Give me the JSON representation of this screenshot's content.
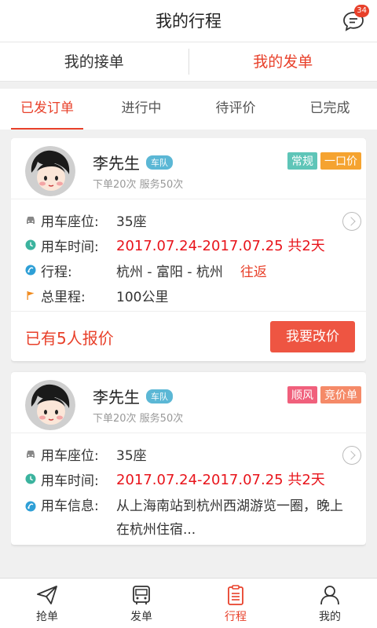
{
  "header": {
    "title": "我的行程",
    "badge": "34"
  },
  "segments": [
    {
      "label": "我的接单"
    },
    {
      "label": "我的发单"
    }
  ],
  "tabs": [
    {
      "label": "已发订单"
    },
    {
      "label": "进行中"
    },
    {
      "label": "待评价"
    },
    {
      "label": "已完成"
    }
  ],
  "orders": [
    {
      "name": "李先生",
      "fleet": "车队",
      "stats": "下单20次  服务50次",
      "tags": [
        {
          "label": "常规",
          "color": "#5ec5b8"
        },
        {
          "label": "一口价",
          "color": "#f5a330"
        }
      ],
      "seat_label": "用车座位:",
      "seat": "35座",
      "time_label": "用车时间:",
      "time": "2017.07.24-2017.07.25 共2天",
      "route_label": "行程:",
      "route": "杭州 - 富阳 - 杭州",
      "route_type": "往返",
      "distance_label": "总里程:",
      "distance": "100公里",
      "quote": "已有5人报价",
      "action": "我要改价"
    },
    {
      "name": "李先生",
      "fleet": "车队",
      "stats": "下单20次  服务50次",
      "tags": [
        {
          "label": "顺风",
          "color": "#f0607c"
        },
        {
          "label": "竞价单",
          "color": "#f58a68"
        }
      ],
      "seat_label": "用车座位:",
      "seat": "35座",
      "time_label": "用车时间:",
      "time": "2017.07.24-2017.07.25  共2天",
      "info_label": "用车信息:",
      "info": "从上海南站到杭州西湖游览一圈，晚上在杭州住宿..."
    }
  ],
  "nav": [
    {
      "label": "抢单"
    },
    {
      "label": "发单"
    },
    {
      "label": "行程"
    },
    {
      "label": "我的"
    }
  ],
  "colors": {
    "accent": "#e8402a",
    "button": "#ee5542"
  }
}
